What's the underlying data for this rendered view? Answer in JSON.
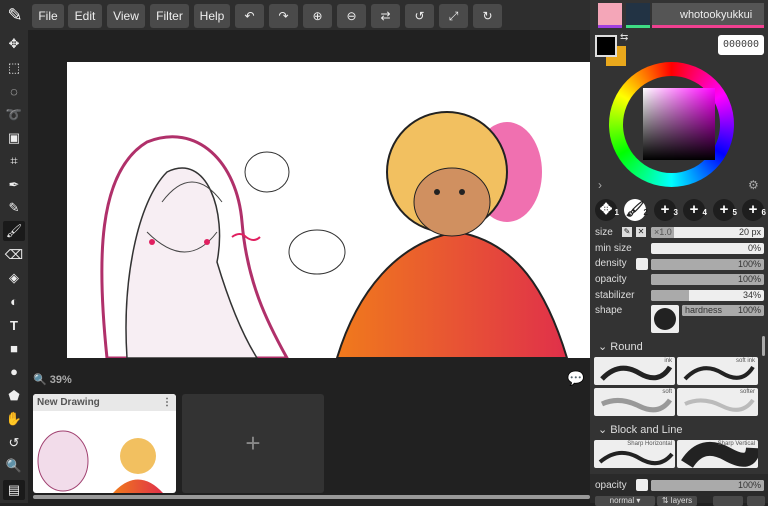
{
  "menu": {
    "file": "File",
    "edit": "Edit",
    "view": "View",
    "filter": "Filter",
    "help": "Help"
  },
  "toolbar_icons": [
    "undo-icon",
    "redo-icon",
    "zoom-in-icon",
    "zoom-out-icon",
    "flip-icon",
    "rotate-left-icon",
    "fit-icon",
    "rotate-right-icon"
  ],
  "canvas": {
    "zoom": "39%"
  },
  "documents": {
    "items": [
      {
        "title": "New Drawing"
      }
    ],
    "add_label": "+"
  },
  "user": {
    "name": "whotookyukkui"
  },
  "colors": {
    "primary": "#000000",
    "secondary": "#e9a81c",
    "hex": "000000"
  },
  "brush_slots": [
    "1",
    "2",
    "3",
    "4",
    "5",
    "6"
  ],
  "brush_settings": {
    "size": {
      "label": "size",
      "multiplier": "×1.0",
      "value": "20 px",
      "fraction": 0.2
    },
    "min_size": {
      "label": "min size",
      "value": "0%",
      "fraction": 0
    },
    "density": {
      "label": "density",
      "value": "100%",
      "fraction": 1
    },
    "opacity": {
      "label": "opacity",
      "value": "100%",
      "fraction": 1
    },
    "stabilizer": {
      "label": "stabilizer",
      "value": "34%",
      "fraction": 0.34
    },
    "shape": {
      "label": "shape",
      "hardness_label": "hardness",
      "hardness": "100%"
    }
  },
  "brush_groups": [
    {
      "name": "Round",
      "brushes": [
        "ink",
        "soft ink",
        "soft",
        "softer"
      ]
    },
    {
      "name": "Block and Line",
      "brushes": [
        "Sharp Horizontal",
        "Sharp Vertical"
      ]
    }
  ],
  "layer": {
    "opacity_label": "opacity",
    "opacity": "100%",
    "blend": "normal ▾",
    "layers_label": "⇅ layers"
  }
}
